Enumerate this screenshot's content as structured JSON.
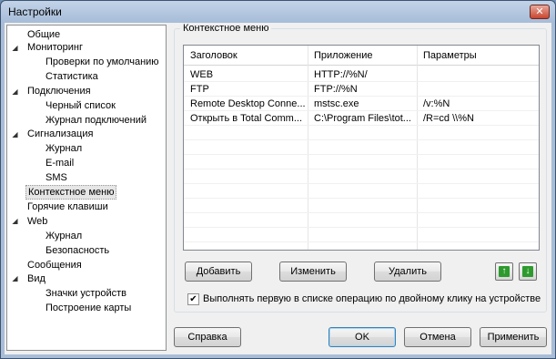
{
  "window": {
    "title": "Настройки",
    "close_label": "✕"
  },
  "tree": {
    "items": [
      {
        "label": "Общие"
      },
      {
        "label": "Мониторинг"
      },
      {
        "label": "Проверки по умолчанию"
      },
      {
        "label": "Статистика"
      },
      {
        "label": "Подключения"
      },
      {
        "label": "Черный список"
      },
      {
        "label": "Журнал подключений"
      },
      {
        "label": "Сигнализация"
      },
      {
        "label": "Журнал"
      },
      {
        "label": "E-mail"
      },
      {
        "label": "SMS"
      },
      {
        "label": "Контекстное меню"
      },
      {
        "label": "Горячие клавиши"
      },
      {
        "label": "Web"
      },
      {
        "label": "Журнал"
      },
      {
        "label": "Безопасность"
      },
      {
        "label": "Сообщения"
      },
      {
        "label": "Вид"
      },
      {
        "label": "Значки устройств"
      },
      {
        "label": "Построение карты"
      }
    ],
    "expander_glyph": "◢"
  },
  "context_menu": {
    "group_title": "Контекстное меню",
    "columns": [
      "Заголовок",
      "Приложение",
      "Параметры"
    ],
    "rows": [
      [
        "WEB",
        "HTTP://%N/",
        ""
      ],
      [
        "FTP",
        "FTP://%N",
        ""
      ],
      [
        "Remote Desktop Conne...",
        "mstsc.exe",
        "/v:%N"
      ],
      [
        "Открыть в Total Comm...",
        "C:\\Program Files\\tot...",
        "/R=cd \\\\%N"
      ]
    ],
    "add_label": "Добавить",
    "edit_label": "Изменить",
    "delete_label": "Удалить",
    "up_glyph": "↑",
    "down_glyph": "↓",
    "checkbox_label": "Выполнять первую в списке операцию по двойному клику на устройстве",
    "checkbox_checked": true,
    "check_glyph": "✔"
  },
  "footer": {
    "help_label": "Справка",
    "ok_label": "OK",
    "cancel_label": "Отмена",
    "apply_label": "Применить"
  }
}
